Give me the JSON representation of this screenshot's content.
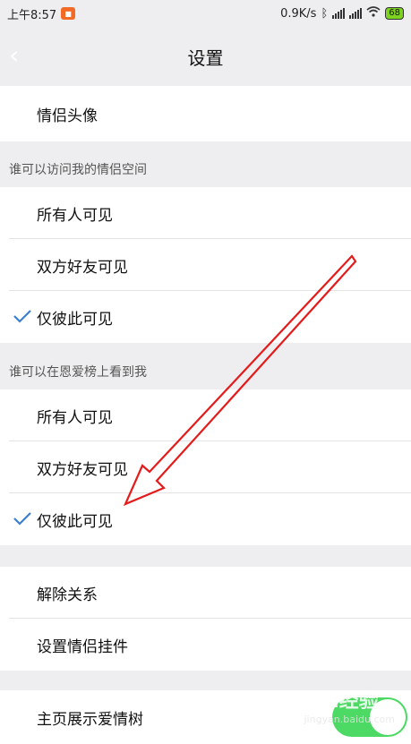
{
  "status_bar": {
    "time": "上午8:57",
    "app_badge": "■",
    "speed": "0.9K/s",
    "battery": "68"
  },
  "header": {
    "title": "设置"
  },
  "top_row": {
    "label": "情侣头像"
  },
  "section1": {
    "title": "谁可以访问我的情侣空间",
    "options": [
      {
        "label": "所有人可见",
        "checked": false
      },
      {
        "label": "双方好友可见",
        "checked": false
      },
      {
        "label": "仅彼此可见",
        "checked": true
      }
    ]
  },
  "section2": {
    "title": "谁可以在恩爱榜上看到我",
    "options": [
      {
        "label": "所有人可见",
        "checked": false
      },
      {
        "label": "双方好友可见",
        "checked": false
      },
      {
        "label": "仅彼此可见",
        "checked": true
      }
    ]
  },
  "actions": {
    "unbind": "解除关系",
    "widget": "设置情侣挂件"
  },
  "love_tree": {
    "label": "主页展示爱情树",
    "enabled": true
  },
  "watermark": {
    "brand": "Bai经验",
    "url": "jingyan.baidu.com"
  },
  "colors": {
    "accent_check": "#3b7fd0",
    "toggle_on": "#4cd964",
    "annotation_arrow": "#e31b1b"
  }
}
